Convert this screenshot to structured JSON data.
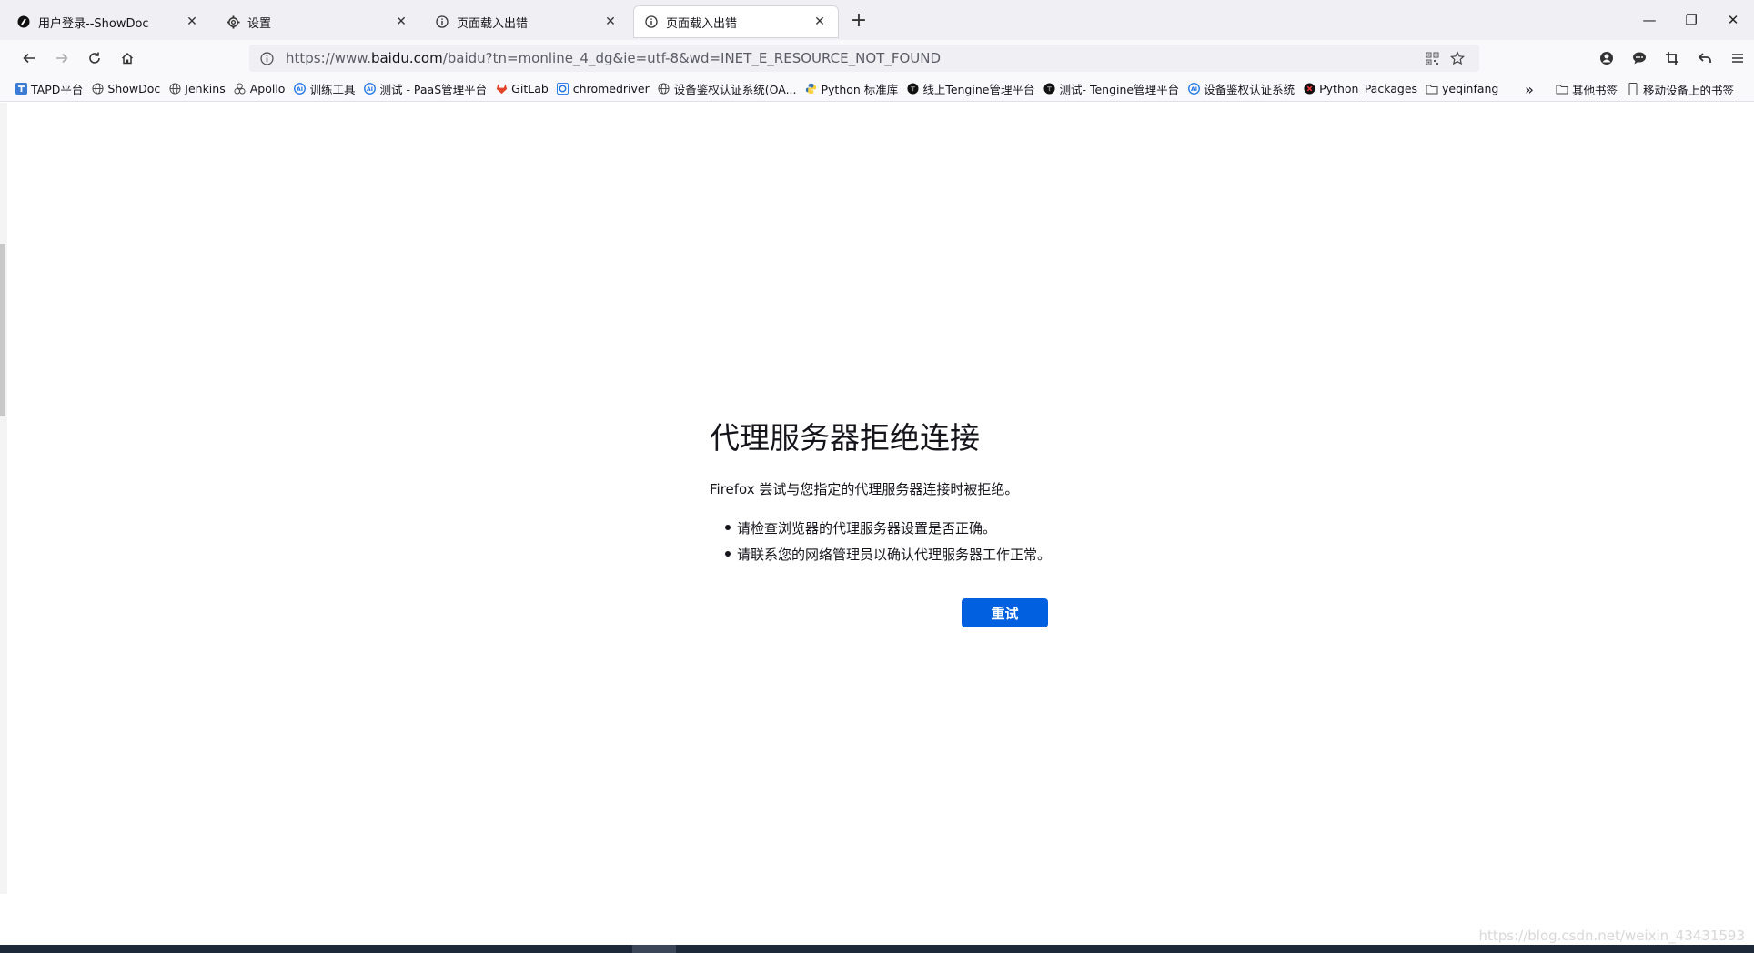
{
  "tabs": [
    {
      "title": "用户登录--ShowDoc",
      "icon": "showdoc-icon"
    },
    {
      "title": "设置",
      "icon": "gear-icon"
    },
    {
      "title": "页面载入出错",
      "icon": "info-icon"
    },
    {
      "title": "页面载入出错",
      "icon": "info-icon",
      "active": true
    }
  ],
  "url": {
    "prefix": "https://www.",
    "domain": "baidu.com",
    "path": "/baidu?tn=monline_4_dg&ie=utf-8&wd=INET_E_RESOURCE_NOT_FOUND"
  },
  "bookmarks": [
    "TAPD平台",
    "ShowDoc",
    "Jenkins",
    "Apollo",
    "训练工具",
    "测试 - PaaS管理平台",
    "GitLab",
    "chromedriver",
    "设备鉴权认证系统(OA...",
    "Python 标准库",
    "线上Tengine管理平台",
    "测试- Tengine管理平台",
    "设备鉴权认证系统",
    "Python_Packages",
    "yeqinfang"
  ],
  "bookmarks_right": [
    "其他书签",
    "移动设备上的书签"
  ],
  "error": {
    "title": "代理服务器拒绝连接",
    "description": "Firefox 尝试与您指定的代理服务器连接时被拒绝。",
    "tips": [
      "请检查浏览器的代理服务器设置是否正确。",
      "请联系您的网络管理员以确认代理服务器工作正常。"
    ],
    "retry_label": "重试"
  },
  "watermark": "https://blog.csdn.net/weixin_43431593",
  "colors": {
    "accent": "#0060df",
    "tabstrip": "#f0f0f4"
  }
}
